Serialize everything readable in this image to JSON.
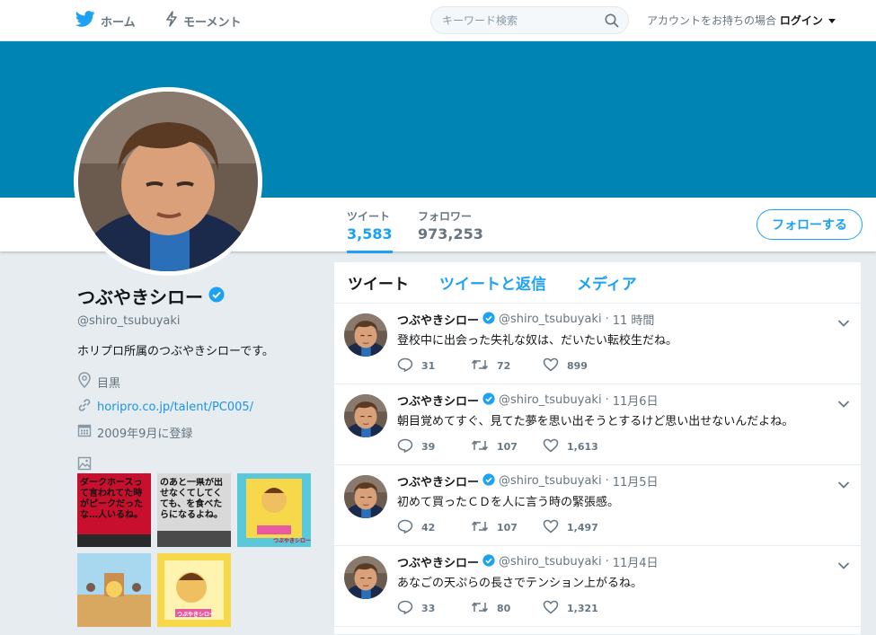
{
  "nav": {
    "home_label": "ホーム",
    "moments_label": "モーメント",
    "search_placeholder": "キーワード検索",
    "account_text": "アカウントをお持ちの場合",
    "login_label": "ログイン",
    "brand_color": "#1da1f2"
  },
  "profile": {
    "name": "つぶやきシロー",
    "handle": "@shiro_tsubuyaki",
    "bio": "ホリプロ所属のつぶやきシローです。",
    "location": "目黒",
    "url": "horipro.co.jp/talent/PC005/",
    "joined": "2009年9月に登録",
    "header_color": "#0084b4"
  },
  "stats": [
    {
      "label": "ツイート",
      "value": "3,583"
    },
    {
      "label": "フォロワー",
      "value": "973,253"
    }
  ],
  "follow_button": "フォローする",
  "media": {
    "icon": "image-icon",
    "thumbs": [
      {
        "text": "ダークホースって言われてた時がピークだったな…人いるね。"
      },
      {
        "text": "のあと一県が出せなくてしてくても、を食べたらになるよね。"
      },
      {
        "text": "つぶやきシロー"
      },
      {
        "text": ""
      },
      {
        "text": "つぶやきシロー"
      }
    ]
  },
  "timeline": {
    "tabs": [
      "ツイート",
      "ツイートと返信",
      "メディア"
    ],
    "tweets": [
      {
        "name": "つぶやきシロー",
        "handle": "@shiro_tsubuyaki",
        "dot": "·",
        "time": "11 時間",
        "text": "登校中に出会った失礼な奴は、だいたい転校生だね。",
        "replies": "31",
        "retweets": "72",
        "likes": "899"
      },
      {
        "name": "つぶやきシロー",
        "handle": "@shiro_tsubuyaki",
        "dot": "·",
        "time": "11月6日",
        "text": "朝目覚めてすぐ、見てた夢を思い出そうとするけど思い出せないんだよね。",
        "replies": "39",
        "retweets": "107",
        "likes": "1,613"
      },
      {
        "name": "つぶやきシロー",
        "handle": "@shiro_tsubuyaki",
        "dot": "·",
        "time": "11月5日",
        "text": "初めて買ったＣＤを人に言う時の緊張感。",
        "replies": "42",
        "retweets": "107",
        "likes": "1,497"
      },
      {
        "name": "つぶやきシロー",
        "handle": "@shiro_tsubuyaki",
        "dot": "·",
        "time": "11月4日",
        "text": "あなごの天ぷらの長さでテンション上がるね。",
        "replies": "33",
        "retweets": "80",
        "likes": "1,321"
      }
    ]
  }
}
